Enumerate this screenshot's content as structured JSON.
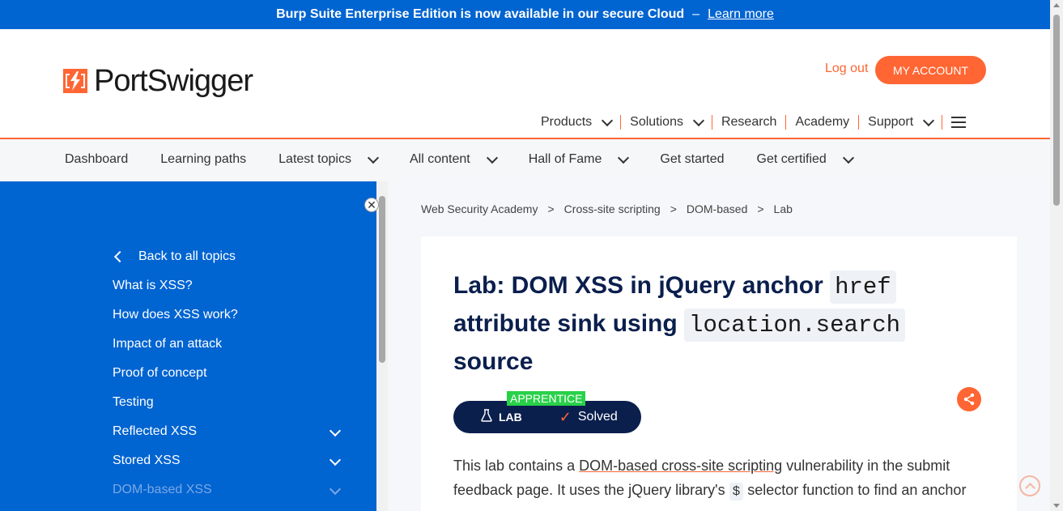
{
  "banner": {
    "text": "Burp Suite Enterprise Edition is now available in our secure Cloud",
    "dash": "–",
    "link": "Learn more"
  },
  "header": {
    "logo_text": "PortSwigger",
    "logout": "Log out",
    "account": "MY ACCOUNT",
    "nav": [
      "Products",
      "Solutions",
      "Research",
      "Academy",
      "Support"
    ]
  },
  "subnav": {
    "items": [
      "Dashboard",
      "Learning paths",
      "Latest topics",
      "All content",
      "Hall of Fame",
      "Get started",
      "Get certified"
    ]
  },
  "sidebar": {
    "back": "Back to all topics",
    "items": [
      "What is XSS?",
      "How does XSS work?",
      "Impact of an attack",
      "Proof of concept",
      "Testing",
      "Reflected XSS",
      "Stored XSS",
      "DOM-based XSS"
    ]
  },
  "breadcrumb": [
    "Web Security Academy",
    "Cross-site scripting",
    "DOM-based",
    "Lab"
  ],
  "breadcrumb_sep": ">",
  "lab": {
    "title_part1": "Lab: DOM XSS in jQuery anchor",
    "code1": "href",
    "title_part2": "attribute sink using",
    "code2": "location.search",
    "title_part3": "source",
    "level": "APPRENTICE",
    "badge_label": "LAB",
    "status": "Solved"
  },
  "body": {
    "p1_start": "This lab contains a",
    "p1_link": "DOM-based cross-site scripting",
    "p1_end": "vulnerability in the submit feedback page. It uses the jQuery library's",
    "p1_code": "$",
    "p1_tail": "selector function to find an anchor"
  },
  "colors": {
    "brand_orange": "#ff6633",
    "brand_blue": "#0064d1",
    "navy": "#0b1f4d",
    "level_green": "#29d149"
  }
}
